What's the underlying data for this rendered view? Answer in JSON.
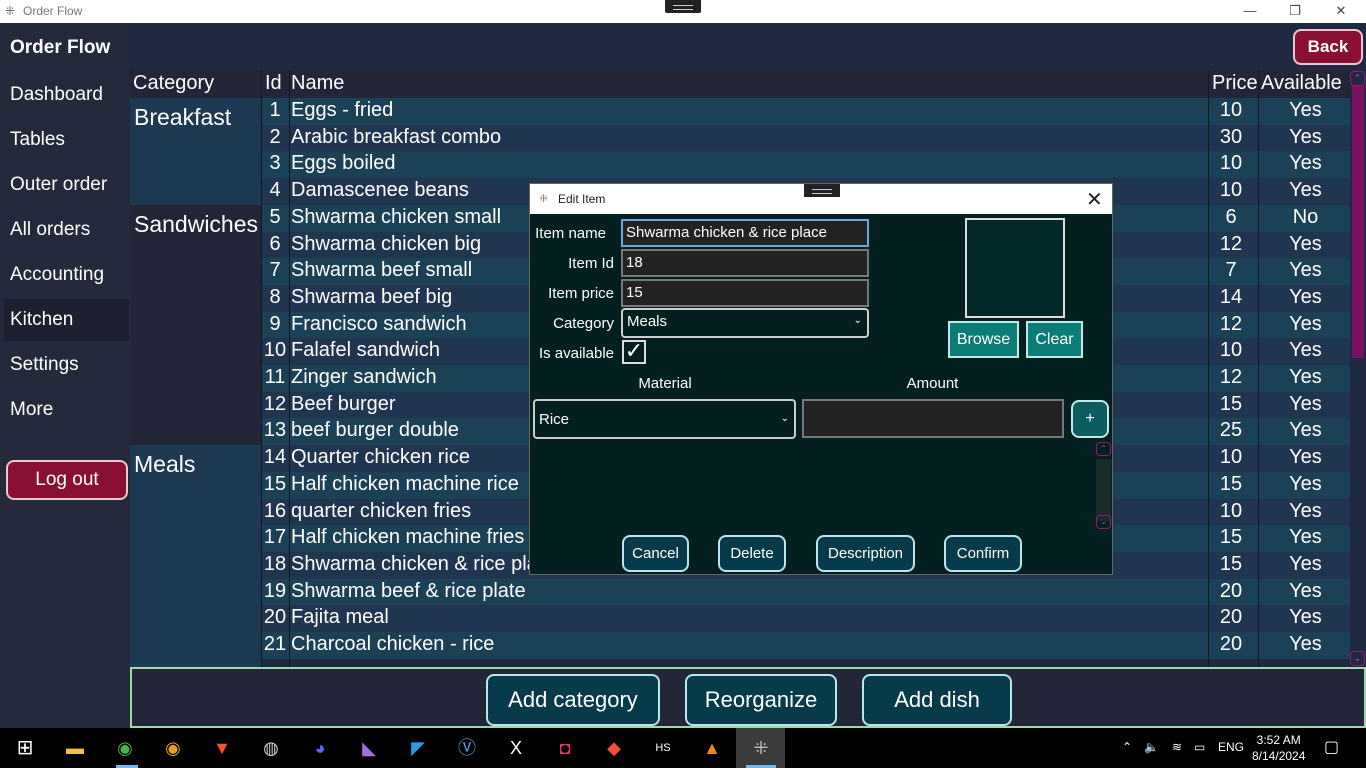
{
  "window": {
    "title": "Order Flow",
    "min": "—",
    "max": "❐",
    "close": "✕"
  },
  "sidebar": {
    "app_name": "Order Flow",
    "items": [
      {
        "label": "Dashboard"
      },
      {
        "label": "Tables"
      },
      {
        "label": "Outer order"
      },
      {
        "label": "All orders"
      },
      {
        "label": "Accounting"
      },
      {
        "label": "Kitchen"
      },
      {
        "label": "Settings"
      },
      {
        "label": "More"
      }
    ],
    "active": "Kitchen",
    "logout": "Log out"
  },
  "header": {
    "back": "Back"
  },
  "table": {
    "columns": {
      "category": "Category",
      "id": "Id",
      "name": "Name",
      "price": "Price",
      "available": "Available"
    },
    "categories": [
      "Breakfast",
      "Sandwiches",
      "Meals"
    ],
    "rows": [
      {
        "id": "1",
        "name": "Eggs - fried",
        "price": "10",
        "available": "Yes"
      },
      {
        "id": "2",
        "name": "Arabic breakfast combo",
        "price": "30",
        "available": "Yes"
      },
      {
        "id": "3",
        "name": "Eggs boiled",
        "price": "10",
        "available": "Yes"
      },
      {
        "id": "4",
        "name": "Damascenee beans",
        "price": "10",
        "available": "Yes"
      },
      {
        "id": "5",
        "name": "Shwarma chicken small",
        "price": "6",
        "available": "No"
      },
      {
        "id": "6",
        "name": "Shwarma chicken big",
        "price": "12",
        "available": "Yes"
      },
      {
        "id": "7",
        "name": "Shwarma beef small",
        "price": "7",
        "available": "Yes"
      },
      {
        "id": "8",
        "name": "Shwarma beef big",
        "price": "14",
        "available": "Yes"
      },
      {
        "id": "9",
        "name": "Francisco sandwich",
        "price": "12",
        "available": "Yes"
      },
      {
        "id": "10",
        "name": "Falafel sandwich",
        "price": "10",
        "available": "Yes"
      },
      {
        "id": "11",
        "name": "Zinger sandwich",
        "price": "12",
        "available": "Yes"
      },
      {
        "id": "12",
        "name": "Beef burger",
        "price": "15",
        "available": "Yes"
      },
      {
        "id": "13",
        "name": "beef burger double",
        "price": "25",
        "available": "Yes"
      },
      {
        "id": "14",
        "name": "Quarter chicken rice",
        "price": "10",
        "available": "Yes"
      },
      {
        "id": "15",
        "name": "Half chicken machine rice",
        "price": "15",
        "available": "Yes"
      },
      {
        "id": "16",
        "name": "quarter chicken fries",
        "price": "10",
        "available": "Yes"
      },
      {
        "id": "17",
        "name": "Half chicken machine fries",
        "price": "15",
        "available": "Yes"
      },
      {
        "id": "18",
        "name": "Shwarma chicken & rice plate",
        "price": "15",
        "available": "Yes"
      },
      {
        "id": "19",
        "name": "Shwarma beef & rice plate",
        "price": "20",
        "available": "Yes"
      },
      {
        "id": "20",
        "name": "Fajita meal",
        "price": "20",
        "available": "Yes"
      },
      {
        "id": "21",
        "name": "Charcoal chicken - rice",
        "price": "20",
        "available": "Yes"
      }
    ]
  },
  "bottom_bar": {
    "add_category": "Add category",
    "reorganize": "Reorganize",
    "add_dish": "Add dish"
  },
  "dialog": {
    "title": "Edit Item",
    "close": "✕",
    "labels": {
      "name": "Item name",
      "id": "Item Id",
      "price": "Item price",
      "category": "Category",
      "available": "Is available"
    },
    "values": {
      "name": "Shwarma chicken & rice place",
      "id": "18",
      "price": "15",
      "category": "Meals",
      "available_check": "✓"
    },
    "browse": "Browse",
    "clear": "Clear",
    "material_header": "Material",
    "amount_header": "Amount",
    "material_value": "Rice",
    "plus": "+",
    "buttons": {
      "cancel": "Cancel",
      "delete": "Delete",
      "description": "Description",
      "confirm": "Confirm"
    }
  },
  "taskbar": {
    "tray_lang": "ENG",
    "time": "3:52 AM",
    "date": "8/14/2024"
  },
  "colors": {
    "accent_maroon": "#8a1033",
    "button_teal": "#073b4c",
    "dialog_bg": "#031f1f"
  }
}
